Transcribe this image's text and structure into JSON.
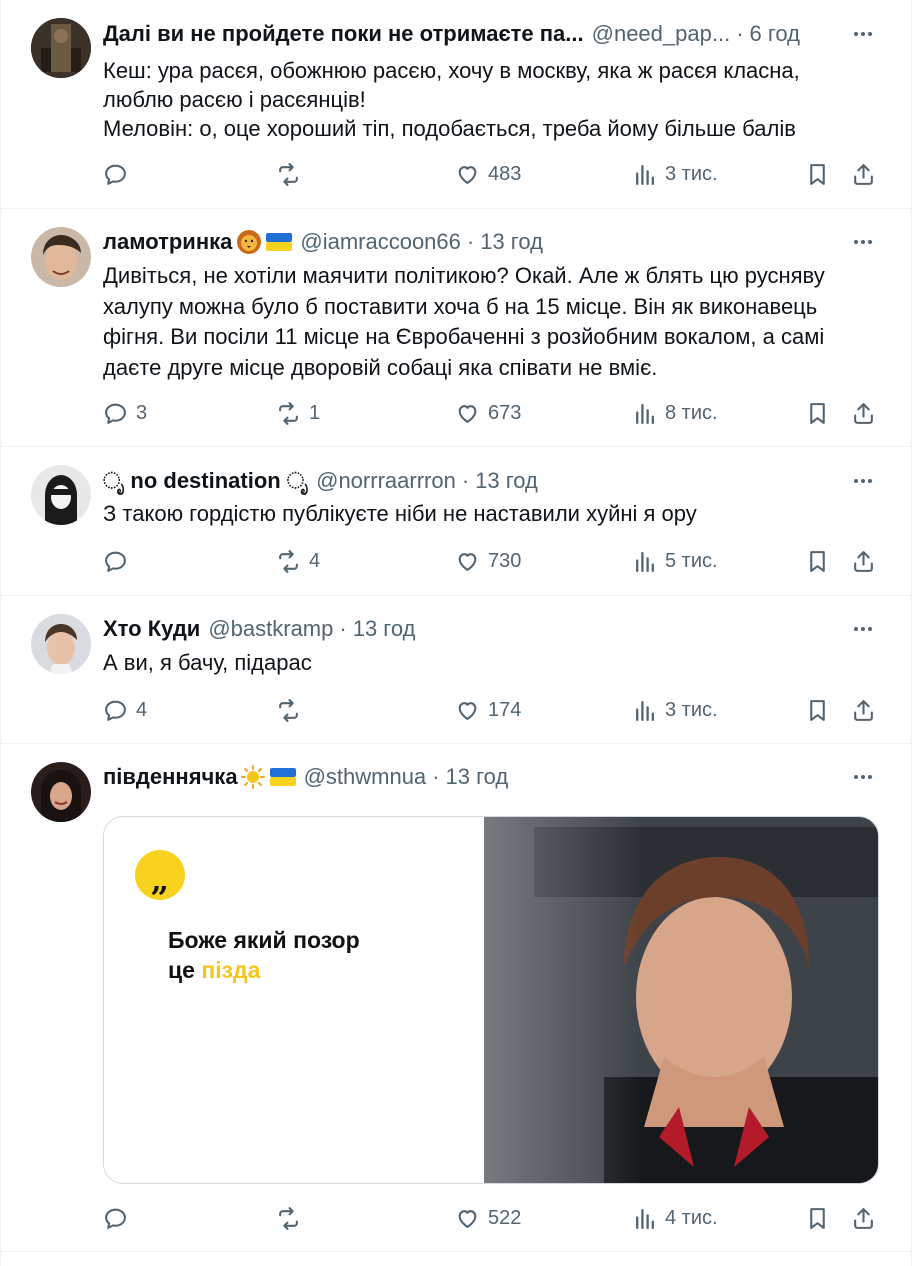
{
  "tweets": [
    {
      "name": "Далі ви не пройдете поки не отримаєте па...",
      "handle": "@need_pap...",
      "time": "6 год",
      "text": [
        "Кеш: ура расєя, обожнюю расєю, хочу в москву, яка ж расєя класна,",
        "люблю расєю і расєянців!",
        "Меловін: о, оце хороший тіп, подобається, треба йому більше балів"
      ],
      "replies": "",
      "reposts": "",
      "likes": "483",
      "views": "3 тис."
    },
    {
      "name": "ламотринка",
      "handle": "@iamraccoon66",
      "time": "13 год",
      "text": [
        "Дивіться, не хотіли маячити політикою? Окай. Але ж блять цю русняву",
        "халупу можна було б поставити хоча б на 15 місце. Він як виконавець",
        "фігня. Ви посіли 11 місце на Євробаченні з розйобним вокалом, а самі",
        "даєте друге місце дворовій собаці яка співати не вміє."
      ],
      "replies": "3",
      "reposts": "1",
      "likes": "673",
      "views": "8 тис."
    },
    {
      "name": "no destination",
      "handle": "@norrraarrron",
      "time": "13 год",
      "text": [
        "З такою гордістю публікуєте ніби не наставили хуйні я ору"
      ],
      "replies": "",
      "reposts": "4",
      "likes": "730",
      "views": "5 тис."
    },
    {
      "name": "Хто Куди",
      "handle": "@bastkramp",
      "time": "13 год",
      "text": [
        "А ви, я бачу, підарас"
      ],
      "replies": "4",
      "reposts": "",
      "likes": "174",
      "views": "3 тис."
    },
    {
      "name": "південнячка",
      "handle": "@sthwmnua",
      "time": "13 год",
      "text": [],
      "media": {
        "line1": "Боже який позор",
        "line2_prefix": "це ",
        "line2_highlight": "пізда"
      },
      "replies": "",
      "reposts": "",
      "likes": "522",
      "views": "4 тис."
    }
  ],
  "icons": {
    "reply": "reply-icon",
    "repost": "repost-icon",
    "like": "heart-icon",
    "views": "views-icon",
    "bookmark": "bookmark-icon",
    "share": "share-icon",
    "more": "more-icon"
  },
  "colors": {
    "secondary_text": "#536471",
    "divider": "#eff3f4",
    "quote_yellow": "#f7d21f",
    "highlight_yellow": "#f5c518"
  }
}
